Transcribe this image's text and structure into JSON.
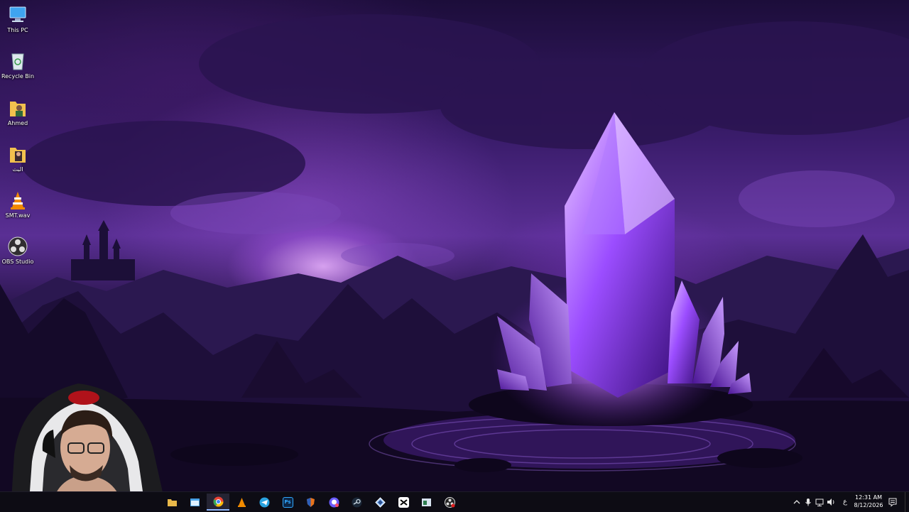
{
  "desktop": {
    "icons": [
      {
        "label": "This PC",
        "icon": "computer-icon"
      },
      {
        "label": "Recycle Bin",
        "icon": "recycle-bin-icon"
      },
      {
        "label": "Ahmed",
        "icon": "user-folder-icon"
      },
      {
        "label": "البث",
        "icon": "folder-icon"
      },
      {
        "label": "SMT.wav",
        "icon": "vlc-cone-icon"
      },
      {
        "label": "OBS Studio",
        "icon": "obs-icon"
      }
    ]
  },
  "taskbar": {
    "apps": [
      {
        "name": "file-explorer",
        "icon": "folder-icon",
        "color": "#e8b84a"
      },
      {
        "name": "window-app",
        "icon": "window-icon",
        "color": "#4aa3e8"
      },
      {
        "name": "chrome",
        "icon": "chrome-icon",
        "color": "#e94235",
        "active": true
      },
      {
        "name": "vlc",
        "icon": "vlc-cone-icon",
        "color": "#f08a00"
      },
      {
        "name": "telegram",
        "icon": "telegram-icon",
        "color": "#2aa3e0"
      },
      {
        "name": "photoshop",
        "icon": "photoshop-icon",
        "color": "#0b2545"
      },
      {
        "name": "app-orange",
        "icon": "shield-icon",
        "color": "#e8731c"
      },
      {
        "name": "discord-like",
        "icon": "chat-icon",
        "color": "#6a5cff"
      },
      {
        "name": "steam",
        "icon": "steam-icon",
        "color": "#1b2838"
      },
      {
        "name": "app-diamond",
        "icon": "diamond-icon",
        "color": "#9ec7ff"
      },
      {
        "name": "capcut",
        "icon": "capcut-icon",
        "color": "#ffffff"
      },
      {
        "name": "app-window",
        "icon": "window-icon",
        "color": "#d7e3f0"
      },
      {
        "name": "obs",
        "icon": "obs-icon",
        "color": "#222222"
      }
    ],
    "tray": {
      "language": "ع",
      "time": "12:31 AM",
      "date": "8/12/2026"
    }
  }
}
